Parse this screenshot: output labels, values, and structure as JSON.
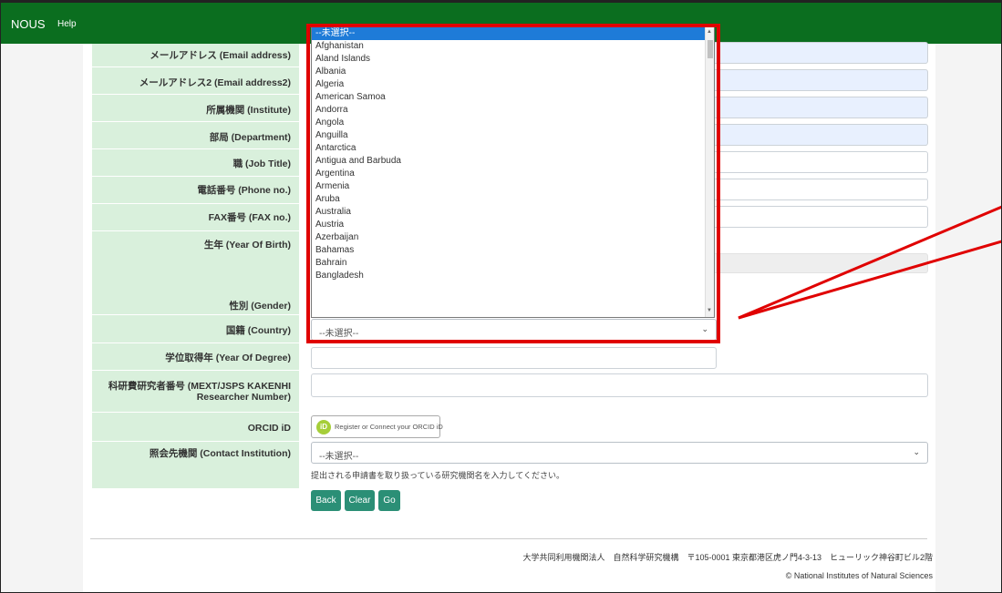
{
  "navbar": {
    "brand": "NOUS",
    "help": "Help"
  },
  "labels": [
    "メールアドレス (Email address)",
    "メールアドレス2 (Email address2)",
    "所属機関 (Institute)",
    "部局 (Department)",
    "職 (Job Title)",
    "電話番号 (Phone no.)",
    "FAX番号 (FAX no.)",
    "生年 (Year Of Birth)",
    "性別 (Gender)",
    "国籍 (Country)",
    "学位取得年 (Year Of Degree)",
    "科研費研究者番号 (MEXT/JSPS KAKENHI Researcher Number)",
    "ORCID iD",
    "照会先機関 (Contact Institution)"
  ],
  "country_select": {
    "value": "--未選択--",
    "options": [
      "--未選択--",
      "Afghanistan",
      "Aland Islands",
      "Albania",
      "Algeria",
      "American Samoa",
      "Andorra",
      "Angola",
      "Anguilla",
      "Antarctica",
      "Antigua and Barbuda",
      "Argentina",
      "Armenia",
      "Aruba",
      "Australia",
      "Austria",
      "Azerbaijan",
      "Bahamas",
      "Bahrain",
      "Bangladesh"
    ]
  },
  "orcid_button": "Register or Connect your ORCID iD",
  "orcid_logo": "iD",
  "contact_select": {
    "value": "--未選択--"
  },
  "contact_hint": "提出される申請書を取り扱っている研究機関名を入力してください。",
  "buttons": {
    "back": "Back",
    "clear": "Clear",
    "go": "Go"
  },
  "footer": {
    "address": "大学共同利用機関法人　自然科学研究機構　〒105-0001 東京都港区虎ノ門4-3-13　ヒューリック神谷町ビル2階",
    "copyright": "© National Institutes of Natural Sciences"
  },
  "colors": {
    "navbar": "#0b6e1f",
    "label_bg": "#d9f0dc",
    "button": "#2b8f76",
    "highlight": "#e00000",
    "selected": "#1e7bd8"
  }
}
